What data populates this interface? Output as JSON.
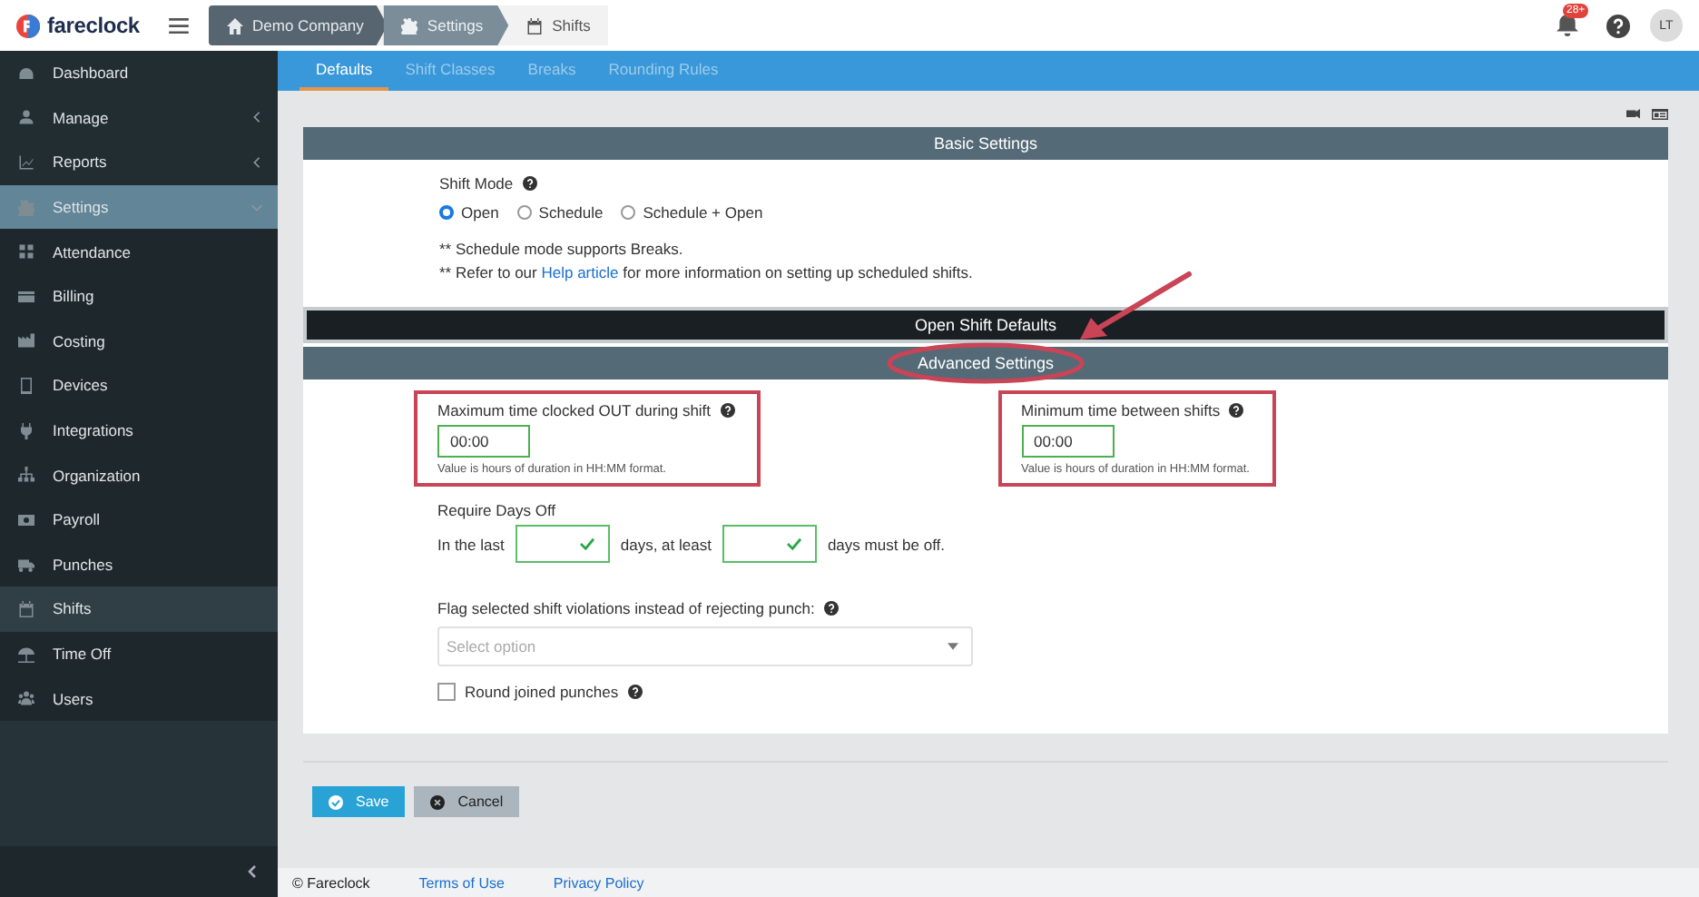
{
  "app": {
    "logo": "fareclock"
  },
  "breadcrumb": [
    {
      "label": "Demo Company"
    },
    {
      "label": "Settings"
    },
    {
      "label": "Shifts"
    }
  ],
  "header": {
    "notifications": "28+",
    "avatar": "LT"
  },
  "sidebar": {
    "items": [
      {
        "label": "Dashboard",
        "selected": false
      },
      {
        "label": "Manage",
        "selected": false,
        "expanded": false
      },
      {
        "label": "Reports",
        "selected": false,
        "expanded": false
      },
      {
        "label": "Settings",
        "selected": true,
        "expanded": true,
        "children": [
          {
            "label": "Attendance",
            "selected": false
          },
          {
            "label": "Billing",
            "selected": false
          },
          {
            "label": "Costing",
            "selected": false
          },
          {
            "label": "Devices",
            "selected": false
          },
          {
            "label": "Integrations",
            "selected": false
          },
          {
            "label": "Organization",
            "selected": false
          },
          {
            "label": "Payroll",
            "selected": false
          },
          {
            "label": "Punches",
            "selected": false
          },
          {
            "label": "Shifts",
            "selected": true
          },
          {
            "label": "Time Off",
            "selected": false
          },
          {
            "label": "Users",
            "selected": false
          }
        ]
      }
    ]
  },
  "tabs": [
    {
      "label": "Defaults",
      "selected": true
    },
    {
      "label": "Shift Classes",
      "selected": false
    },
    {
      "label": "Breaks",
      "selected": false
    },
    {
      "label": "Rounding Rules",
      "selected": false
    }
  ],
  "basic_settings": {
    "title": "Basic Settings",
    "shift_mode": {
      "label": "Shift Mode",
      "options": [
        {
          "label": "Open",
          "selected": true
        },
        {
          "label": "Schedule",
          "selected": false
        },
        {
          "label": "Schedule + Open",
          "selected": false
        }
      ]
    },
    "notes": [
      "** Schedule mode supports Breaks.",
      "** Refer to our "
    ],
    "help_link": "Help article",
    "note_tail": " for more information on setting up scheduled shifts."
  },
  "open_shift_defaults": {
    "title": "Open Shift Defaults"
  },
  "advanced_settings": {
    "title": "Advanced Settings",
    "duration_fields": [
      {
        "label": "Maximum time clocked OUT during shift",
        "value": "00:00",
        "hint": "Value is hours of duration in HH:MM format.",
        "valid": true
      },
      {
        "label": "Minimum time between shifts",
        "value": "00:00",
        "hint": "Value is hours of duration in HH:MM format.",
        "valid": true
      }
    ],
    "require_days_off": {
      "label": "Require Days Off",
      "parts": [
        "In the last",
        "days, at least",
        "days must be off."
      ],
      "fields": [
        {
          "valid": true
        },
        {
          "valid": true
        }
      ]
    },
    "flag_violations": {
      "label": "Flag selected shift violations instead of rejecting punch:",
      "placeholder": "Select option"
    },
    "round_joined_punches": {
      "label": "Round joined punches",
      "checked": false
    }
  },
  "buttons": [
    {
      "label": "Save",
      "kind": "primary"
    },
    {
      "label": "Cancel",
      "kind": "secondary"
    }
  ],
  "footer": {
    "copyright": "© Fareclock",
    "links": [
      "Terms of Use",
      "Privacy Policy"
    ]
  }
}
